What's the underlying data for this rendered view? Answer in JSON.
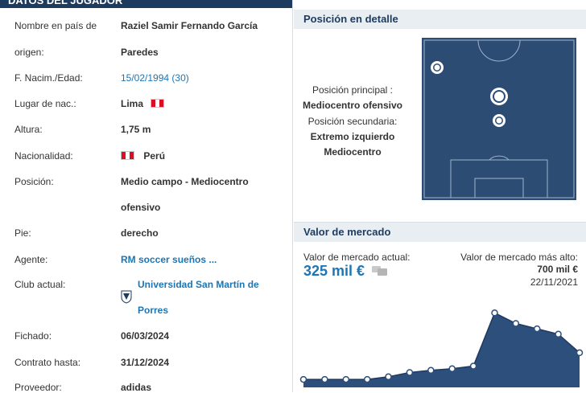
{
  "player": {
    "header_title": "DATOS DEL JUGADOR",
    "rows": {
      "name_label_1": "Nombre en país de",
      "name_label_2": "origen:",
      "name_value_1": "Raziel Samir Fernando García",
      "name_value_2": "Paredes",
      "birth_label": "F. Nacim./Edad:",
      "birth_value": "15/02/1994 (30)",
      "place_label": "Lugar de nac.:",
      "place_value": "Lima",
      "height_label": "Altura:",
      "height_value": "1,75 m",
      "nationality_label": "Nacionalidad:",
      "nationality_value": "Perú",
      "position_label": "Posición:",
      "position_value_1": "Medio campo - Mediocentro",
      "position_value_2": "ofensivo",
      "foot_label": "Pie:",
      "foot_value": "derecho",
      "agent_label": "Agente:",
      "agent_value": "RM soccer sueños ...",
      "club_label": "Club actual:",
      "club_value_1": "Universidad San Martín de",
      "club_value_2": "Porres",
      "joined_label": "Fichado:",
      "joined_value": "06/03/2024",
      "contract_label": "Contrato hasta:",
      "contract_value": "31/12/2024",
      "supplier_label": "Proveedor:",
      "supplier_value": "adidas"
    },
    "flag": "peru-flag",
    "club_icon": "usmp-club-crest"
  },
  "position_detail": {
    "title": "Posición en detalle",
    "main_label": "Posición principal :",
    "main_value": "Mediocentro ofensivo",
    "secondary_label": "Posición secundaria:",
    "secondary_value_1": "Extremo izquierdo",
    "secondary_value_2": "Mediocentro",
    "pitch_color": "#2c4c74"
  },
  "market_value": {
    "title": "Valor de mercado",
    "current_label": "Valor de mercado actual:",
    "current_value": "325 mil €",
    "max_label": "Valor de mercado más alto:",
    "max_value": "700 mil €",
    "max_date": "22/11/2021",
    "accent": "#1d75b3",
    "area_color": "#2d4f7c"
  },
  "chart_data": {
    "type": "area",
    "values": [
      75,
      75,
      75,
      75,
      100,
      140,
      160,
      175,
      200,
      700,
      600,
      550,
      500,
      325
    ],
    "ylim": [
      0,
      800
    ]
  }
}
